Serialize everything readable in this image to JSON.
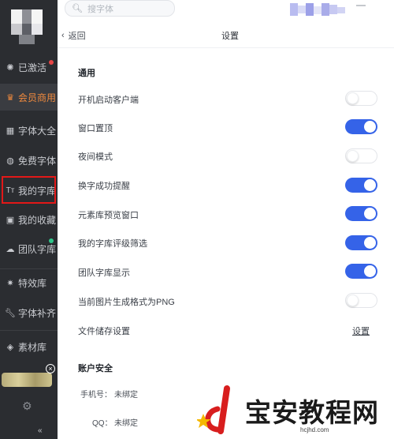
{
  "top_bar": {
    "search_placeholder": "搜字体"
  },
  "header": {
    "back_label": "返回",
    "title": "设置"
  },
  "sidebar": {
    "items": [
      {
        "label": "已激活",
        "icon": "bulb-icon"
      },
      {
        "label": "会员商用",
        "icon": "crown-icon"
      },
      {
        "label": "字体大全",
        "icon": "grid-icon"
      },
      {
        "label": "免费字体",
        "icon": "globe-icon"
      },
      {
        "label": "我的字库",
        "icon": "font-tt-icon"
      },
      {
        "label": "我的收藏",
        "icon": "star-box-icon"
      },
      {
        "label": "团队字库",
        "icon": "cloud-icon"
      },
      {
        "label": "特效库",
        "icon": "sparkle-icon"
      },
      {
        "label": "字体补齐",
        "icon": "wrench-icon"
      },
      {
        "label": "素材库",
        "icon": "layers-icon"
      }
    ],
    "active_index": 1,
    "highlighted_index": 4
  },
  "settings": {
    "general_title": "通用",
    "rows": [
      {
        "label": "开机启动客户端",
        "on": false
      },
      {
        "label": "窗口置顶",
        "on": true
      },
      {
        "label": "夜间模式",
        "on": false
      },
      {
        "label": "换字成功提醒",
        "on": true
      },
      {
        "label": "元素库预览窗口",
        "on": true
      },
      {
        "label": "我的字库评级筛选",
        "on": true
      },
      {
        "label": "团队字库显示",
        "on": true
      },
      {
        "label": "当前图片生成格式为PNG",
        "on": false
      }
    ],
    "storage": {
      "label": "文件储存设置",
      "action": "设置"
    },
    "account_title": "账户安全",
    "phone": {
      "label": "手机号：",
      "value": "未绑定"
    },
    "qq": {
      "label": "QQ：",
      "value": "未绑定"
    }
  },
  "watermark": {
    "text": "宝安教程网",
    "url": "hcjhd.com"
  },
  "colors": {
    "sidebar_bg": "#2b2d31",
    "accent_on": "#3563e8",
    "active_text": "#f08a3e",
    "highlight_box": "#e21818"
  }
}
